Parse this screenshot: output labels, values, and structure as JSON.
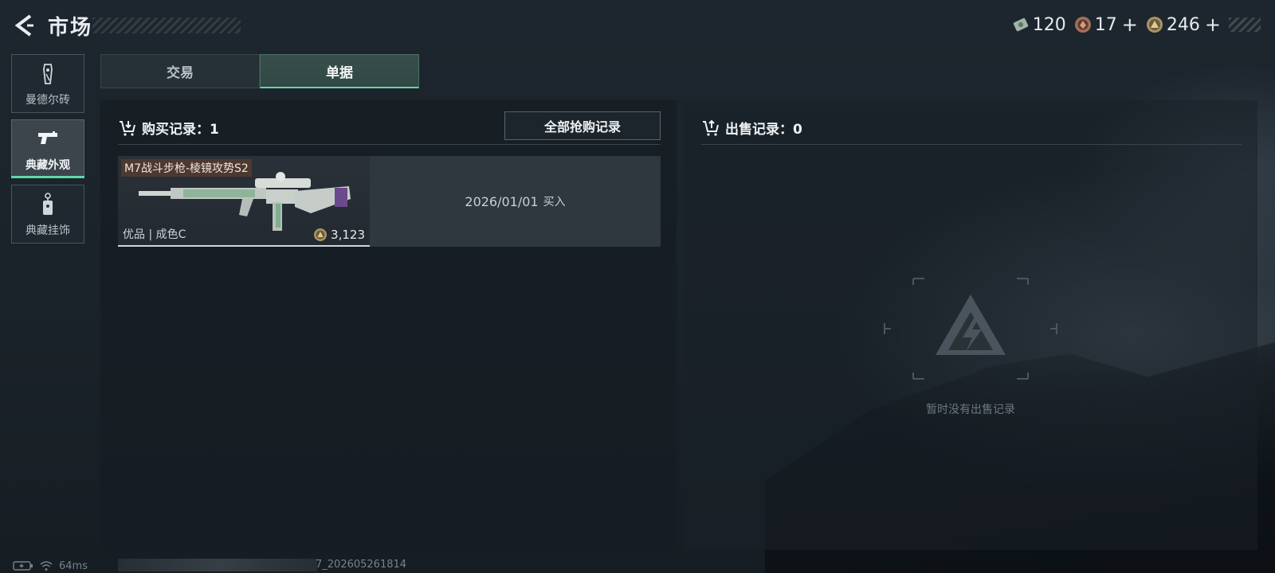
{
  "header": {
    "title": "市场",
    "currencies": [
      {
        "icon": "cash-icon",
        "value": "120",
        "has_plus": false
      },
      {
        "icon": "bronze-token-icon",
        "value": "17",
        "has_plus": true
      },
      {
        "icon": "gold-coin-icon",
        "value": "246",
        "has_plus": true
      }
    ],
    "plus_symbol": "+"
  },
  "sidebar": {
    "items": [
      {
        "label": "曼德尔砖",
        "icon": "mandel-brick-icon",
        "active": false
      },
      {
        "label": "典藏外观",
        "icon": "pistol-icon",
        "active": true
      },
      {
        "label": "典藏挂饰",
        "icon": "charm-tag-icon",
        "active": false
      }
    ]
  },
  "tabs": [
    {
      "label": "交易",
      "active": false
    },
    {
      "label": "单据",
      "active": true
    }
  ],
  "purchase": {
    "header": "购买记录：1",
    "all_records_label": "全部抢购记录",
    "records": [
      {
        "item_name": "M7战斗步枪-棱镜攻势S2",
        "grade": "优品 | 成色C",
        "price": "3,123",
        "date": "2026/01/01",
        "action": "买入"
      }
    ]
  },
  "sales": {
    "header": "出售记录：0",
    "empty_text": "暂时没有出售记录"
  },
  "statusbar": {
    "ping": "64ms",
    "build": "7_202605261814"
  },
  "colors": {
    "accent": "#5fd7a4",
    "panel_bg": "#161c22",
    "text": "#d8dde2"
  }
}
